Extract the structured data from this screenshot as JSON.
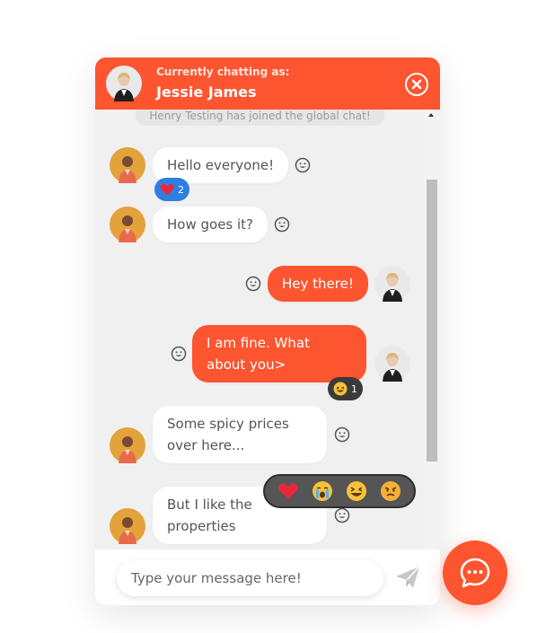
{
  "header": {
    "caption": "Currently chatting as:",
    "user_name": "Jessie James"
  },
  "system_message": "Henry Testing has joined the global chat!",
  "messages": [
    {
      "direction": "incoming",
      "text": "Hello everyone!",
      "reaction": {
        "icon": "heart-icon",
        "count": "2"
      }
    },
    {
      "direction": "incoming",
      "text": "How goes it?"
    },
    {
      "direction": "outgoing",
      "text": "Hey there!"
    },
    {
      "direction": "outgoing",
      "text": "I am fine. What about you>",
      "reaction": {
        "icon": "laughing-face-icon",
        "count": "1"
      }
    },
    {
      "direction": "incoming",
      "text": "Some spicy prices over here..."
    },
    {
      "direction": "incoming",
      "text": "But I like the properties"
    }
  ],
  "emoji_picker": [
    "heart-icon",
    "crying-face-icon",
    "laughing-face-icon",
    "angry-face-icon"
  ],
  "input": {
    "placeholder": "Type your message here!"
  },
  "colors": {
    "accent": "#fd5530",
    "badge_blue": "#2f7fe0",
    "badge_dark": "#3a3a3a",
    "panel": "#f0f0f0"
  }
}
